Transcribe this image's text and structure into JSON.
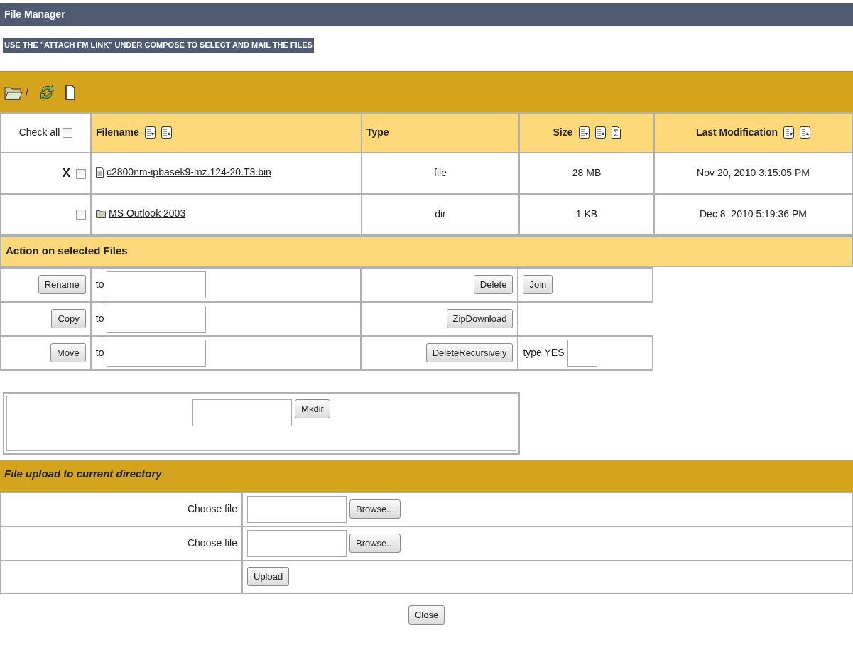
{
  "title": "File Manager",
  "notice": "USE THE \"ATTACH FM LINK\" UNDER COMPOSE TO SELECT AND MAIL THE FILES",
  "toolbar": {
    "path": "/"
  },
  "check_all": {
    "label": "Check all",
    "checked": false
  },
  "columns": [
    {
      "label": "Filename",
      "centered": false,
      "sortable": true,
      "summable": false
    },
    {
      "label": "Type",
      "centered": false,
      "sortable": false,
      "summable": false
    },
    {
      "label": "Size",
      "centered": true,
      "sortable": true,
      "summable": true
    },
    {
      "label": "Last Modification",
      "centered": true,
      "sortable": true,
      "summable": false
    }
  ],
  "rows": [
    {
      "kind": "file",
      "delete_mark": "X",
      "checked": false,
      "name": "c2800nm-ipbasek9-mz.124-20.T3.bin",
      "type": "file",
      "size": "28 MB",
      "modified": "Nov 20, 2010 3:15:05 PM"
    },
    {
      "kind": "dir",
      "checked": false,
      "name": "MS Outlook 2003",
      "type": "dir",
      "size": "1 KB",
      "modified": "Dec 8, 2010 5:19:36 PM"
    }
  ],
  "actions": {
    "title": "Action on selected Files",
    "rows": [
      {
        "button": "Rename",
        "to_label": "to",
        "right_button": "Delete",
        "extra": {
          "kind": "button",
          "label": "Join"
        }
      },
      {
        "button": "Copy",
        "to_label": "to",
        "right_button": "ZipDownload"
      },
      {
        "button": "Move",
        "to_label": "to",
        "right_button": "DeleteRecursively",
        "extra": {
          "kind": "confirm",
          "label": "type YES"
        }
      }
    ]
  },
  "mkdir": {
    "button": "Mkdir"
  },
  "upload": {
    "title": "File upload to current directory",
    "files": [
      {
        "label": "Choose file",
        "button": "Browse..."
      },
      {
        "label": "Choose file",
        "button": "Browse..."
      }
    ],
    "submit": "Upload"
  },
  "close": "Close"
}
